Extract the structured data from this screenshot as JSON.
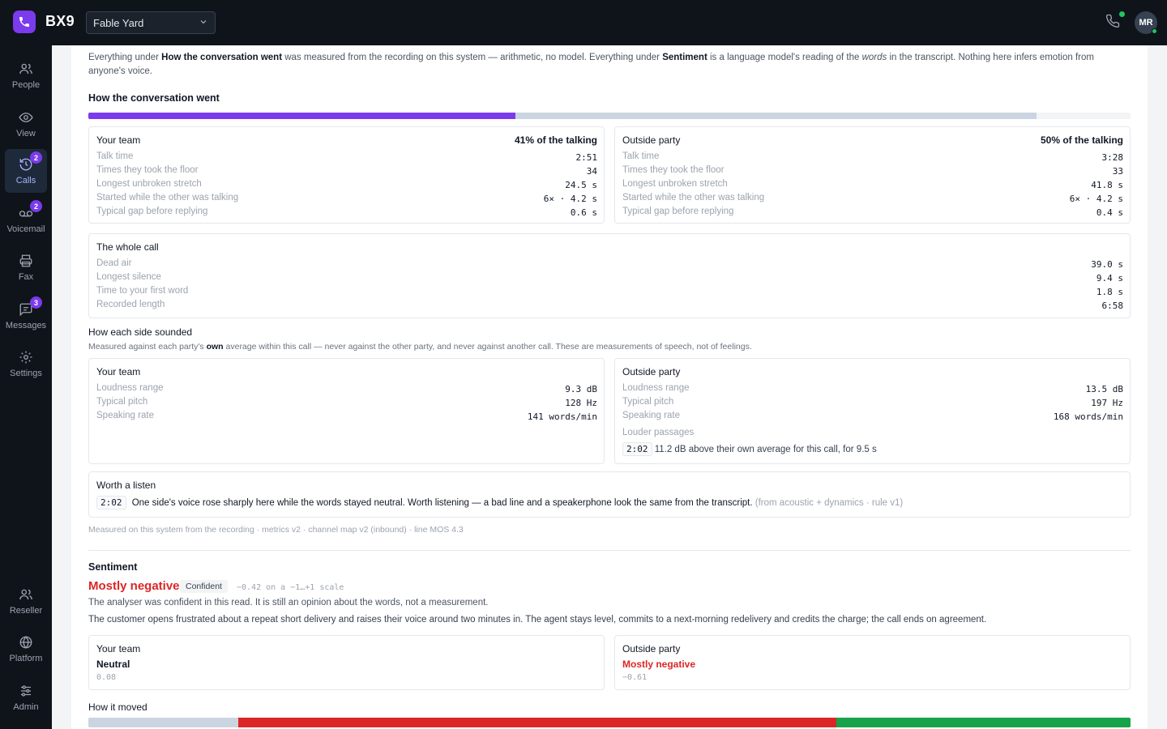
{
  "app": {
    "brand": "BX9",
    "site": "Fable Yard",
    "avatar_initials": "MR"
  },
  "colors": {
    "accent": "#7c3aed",
    "negative": "#dc2626",
    "positive": "#16a34a",
    "neutral_bar": "#cbd5e1"
  },
  "sidebar": {
    "items": [
      {
        "label": "People",
        "icon": "people-icon"
      },
      {
        "label": "View",
        "icon": "eye-icon"
      },
      {
        "label": "Calls",
        "icon": "history-icon",
        "badge": "2",
        "active": true
      },
      {
        "label": "Voicemail",
        "icon": "voicemail-icon",
        "badge": "2"
      },
      {
        "label": "Fax",
        "icon": "printer-icon"
      },
      {
        "label": "Messages",
        "icon": "message-icon",
        "badge": "3"
      },
      {
        "label": "Settings",
        "icon": "gear-icon"
      }
    ],
    "bottom": [
      {
        "label": "Reseller",
        "icon": "people-icon"
      },
      {
        "label": "Platform",
        "icon": "globe-icon"
      },
      {
        "label": "Admin",
        "icon": "sliders-icon"
      }
    ]
  },
  "intro": {
    "p1": "Everything under ",
    "b1": "How the conversation went",
    "p2": " was measured from the recording on this system — arithmetic, no model. Everything under ",
    "b2": "Sentiment",
    "p3": " is a language model's reading of the ",
    "i1": "words",
    "p4": " in the transcript. Nothing here infers emotion from anyone's voice."
  },
  "conversation": {
    "heading": "How the conversation went",
    "talk_share": {
      "team": 0.41,
      "outside": 0.5
    },
    "team": {
      "title": "Your team",
      "share": "41% of the talking",
      "rows": [
        {
          "label": "Talk time",
          "value": "2:51"
        },
        {
          "label": "Times they took the floor",
          "value": "34"
        },
        {
          "label": "Longest unbroken stretch",
          "value": "24.5 s"
        },
        {
          "label": "Started while the other was talking",
          "value": "6× · 4.2 s"
        },
        {
          "label": "Typical gap before replying",
          "value": "0.6 s"
        }
      ]
    },
    "outside": {
      "title": "Outside party",
      "share": "50% of the talking",
      "rows": [
        {
          "label": "Talk time",
          "value": "3:28"
        },
        {
          "label": "Times they took the floor",
          "value": "33"
        },
        {
          "label": "Longest unbroken stretch",
          "value": "41.8 s"
        },
        {
          "label": "Started while the other was talking",
          "value": "6× · 4.2 s"
        },
        {
          "label": "Typical gap before replying",
          "value": "0.4 s"
        }
      ]
    },
    "whole": {
      "title": "The whole call",
      "rows": [
        {
          "label": "Dead air",
          "value": "39.0 s"
        },
        {
          "label": "Longest silence",
          "value": "9.4 s"
        },
        {
          "label": "Time to your first word",
          "value": "1.8 s"
        },
        {
          "label": "Recorded length",
          "value": "6:58"
        }
      ]
    }
  },
  "sounded": {
    "heading": "How each side sounded",
    "note_a": "Measured against each party's ",
    "note_b": "own",
    "note_c": " average within this call — never against the other party, and never against another call. These are measurements of speech, not of feelings.",
    "team": {
      "title": "Your team",
      "rows": [
        {
          "label": "Loudness range",
          "value": "9.3 dB"
        },
        {
          "label": "Typical pitch",
          "value": "128 Hz"
        },
        {
          "label": "Speaking rate",
          "value": "141 words/min"
        }
      ]
    },
    "outside": {
      "title": "Outside party",
      "rows": [
        {
          "label": "Loudness range",
          "value": "13.5 dB"
        },
        {
          "label": "Typical pitch",
          "value": "197 Hz"
        },
        {
          "label": "Speaking rate",
          "value": "168 words/min"
        }
      ],
      "louder_label": "Louder passages",
      "louder_time": "2:02",
      "louder_text": "11.2 dB above their own average for this call, for 9.5 s"
    }
  },
  "listen": {
    "title": "Worth a listen",
    "time": "2:02",
    "text": "One side's voice rose sharply here while the words stayed neutral. Worth listening — a bad line and a speakerphone look the same from the transcript.",
    "source": "(from acoustic + dynamics · rule v1)"
  },
  "footnote": "Measured on this system from the recording · metrics v2 · channel map v2 (inbound) · line MOS 4.3",
  "sentiment": {
    "heading": "Sentiment",
    "overall": "Mostly negative",
    "confidence": "Confident",
    "score": "−0.42 on a −1…+1 scale",
    "confidence_note": "The analyser was confident in this read. It is still an opinion about the words, not a measurement.",
    "summary": "The customer opens frustrated about a repeat short delivery and raises their voice around two minutes in. The agent stays level, commits to a next-morning redelivery and credits the charge; the call ends on agreement.",
    "team": {
      "title": "Your team",
      "label": "Neutral",
      "score": "0.08"
    },
    "outside": {
      "title": "Outside party",
      "label": "Mostly negative",
      "score": "−0.61"
    },
    "moved_heading": "How it moved",
    "moved_segments": [
      {
        "tone": "neutral",
        "share": 0.144
      },
      {
        "tone": "negative",
        "share": 0.574
      },
      {
        "tone": "positive",
        "share": 0.282
      }
    ]
  }
}
